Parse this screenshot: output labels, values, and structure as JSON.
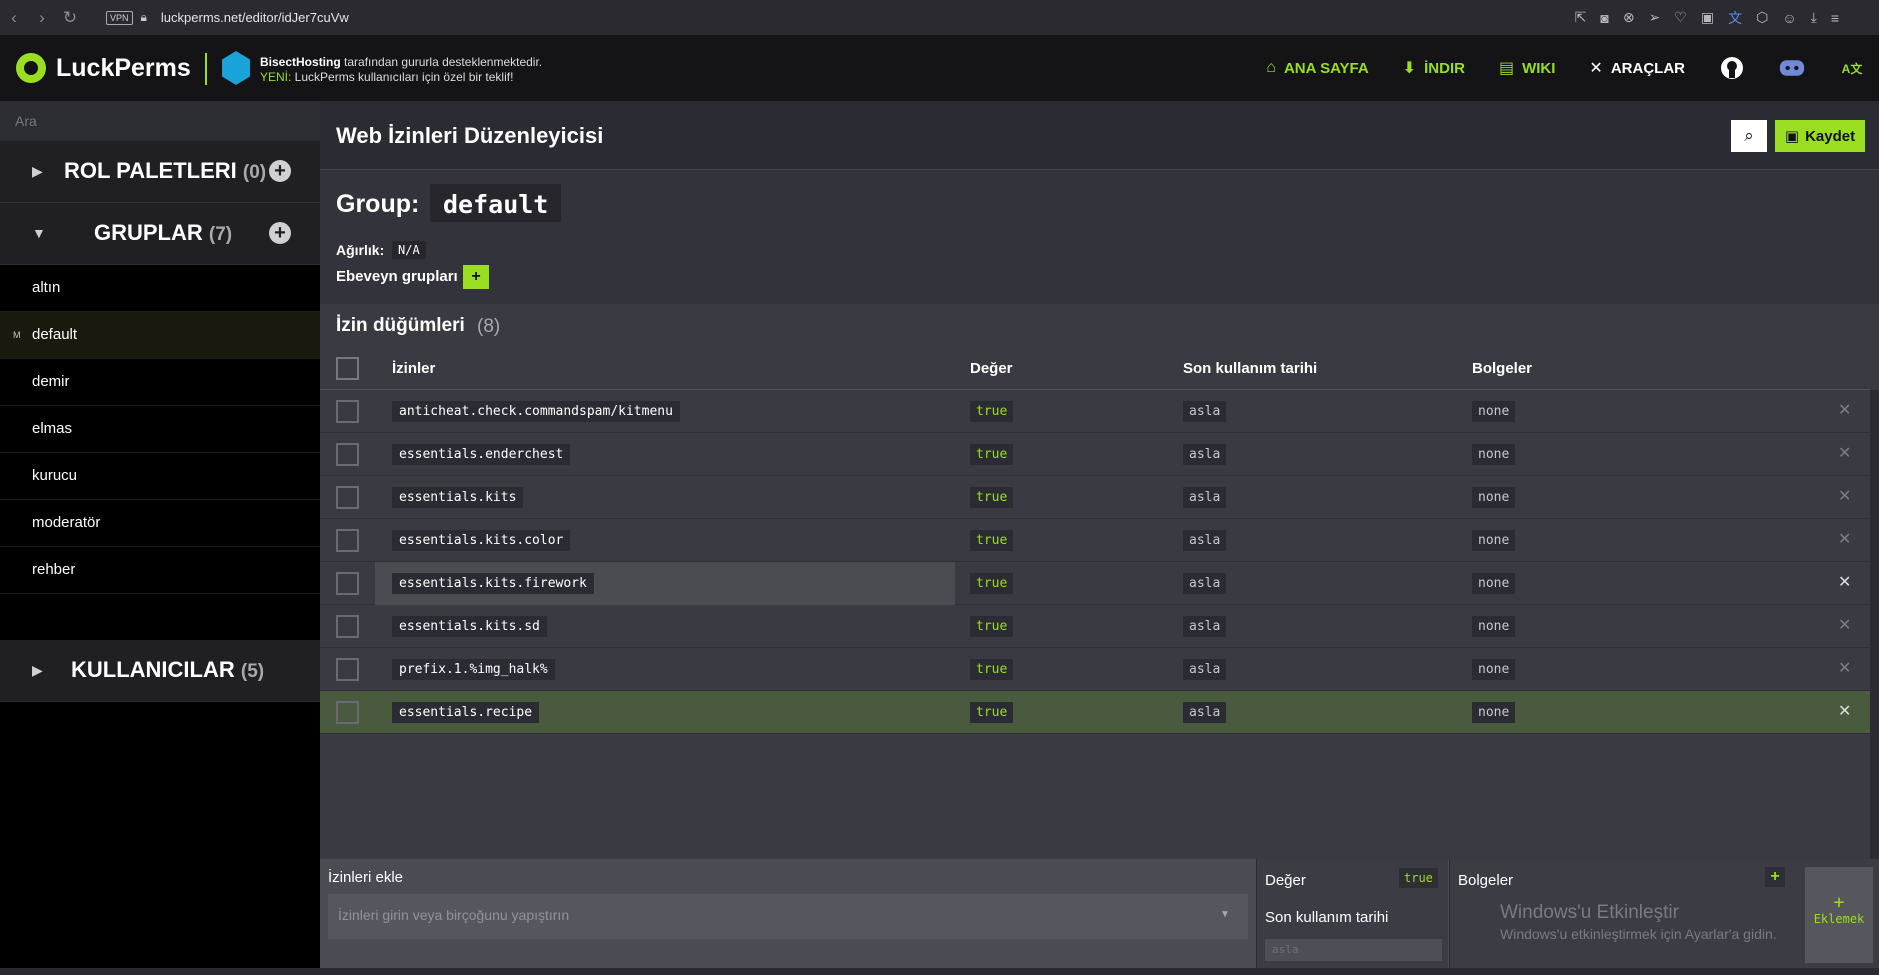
{
  "browser": {
    "url": "luckperms.net/editor/idJer7cuVw",
    "vpn": "VPN"
  },
  "header": {
    "logo": "LuckPerms",
    "sponsor_name": "BisectHosting",
    "sponsor_text": " tarafından gururla desteklenmektedir.",
    "sponsor_new": "YENİ:",
    "sponsor_offer": " LuckPerms kullanıcıları için özel bir teklif!",
    "nav": {
      "home": "ANA SAYFA",
      "download": "İNDIR",
      "wiki": "WIKI",
      "tools": "ARAÇLAR"
    }
  },
  "sidebar": {
    "search_placeholder": "Ara",
    "tracks": {
      "label": "ROL PALETLERI",
      "count": "(0)"
    },
    "groups": {
      "label": "GRUPLAR",
      "count": "(7)"
    },
    "group_items": [
      "altın",
      "default",
      "demir",
      "elmas",
      "kurucu",
      "moderatör",
      "rehber"
    ],
    "active_mark": "M",
    "users": {
      "label": "KULLANICILAR",
      "count": "(5)"
    }
  },
  "editor": {
    "title": "Web İzinleri Düzenleyicisi",
    "save_label": "Kaydet",
    "group_label": "Group:",
    "group_name": "default",
    "weight_label": "Ağırlık:",
    "weight_value": "N/A",
    "parents_label": "Ebeveyn grupları",
    "parents_add": "+"
  },
  "permissions": {
    "heading": "İzin düğümleri",
    "count": "(8)",
    "columns": {
      "perm": "İzinler",
      "value": "Değer",
      "expiry": "Son kullanım tarihi",
      "contexts": "Bolgeler"
    },
    "rows": [
      {
        "perm": "anticheat.check.commandspam/kitmenu",
        "value": "true",
        "expiry": "asla",
        "contexts": "none"
      },
      {
        "perm": "essentials.enderchest",
        "value": "true",
        "expiry": "asla",
        "contexts": "none"
      },
      {
        "perm": "essentials.kits",
        "value": "true",
        "expiry": "asla",
        "contexts": "none"
      },
      {
        "perm": "essentials.kits.color",
        "value": "true",
        "expiry": "asla",
        "contexts": "none"
      },
      {
        "perm": "essentials.kits.firework",
        "value": "true",
        "expiry": "asla",
        "contexts": "none"
      },
      {
        "perm": "essentials.kits.sd",
        "value": "true",
        "expiry": "asla",
        "contexts": "none"
      },
      {
        "perm": "prefix.1.%img_halk%",
        "value": "true",
        "expiry": "asla",
        "contexts": "none"
      },
      {
        "perm": "essentials.recipe",
        "value": "true",
        "expiry": "asla",
        "contexts": "none"
      }
    ]
  },
  "add_form": {
    "label": "İzinleri ekle",
    "placeholder": "İzinleri girin veya birçoğunu yapıştırın",
    "value_label": "Değer",
    "value_toggle": "true",
    "expiry_label": "Son kullanım tarihi",
    "expiry_placeholder": "asla",
    "contexts_label": "Bolgeler",
    "contexts_add": "+",
    "submit_plus": "+",
    "submit_label": "Eklemek"
  },
  "windows_overlay": {
    "line1": "Windows'u Etkinleştir",
    "line2": "Windows'u etkinleştirmek için Ayarlar'a gidin."
  },
  "colors": {
    "accent": "#9ade22",
    "sidebar_bg": "#000000",
    "main_bg": "#3a3a43"
  }
}
